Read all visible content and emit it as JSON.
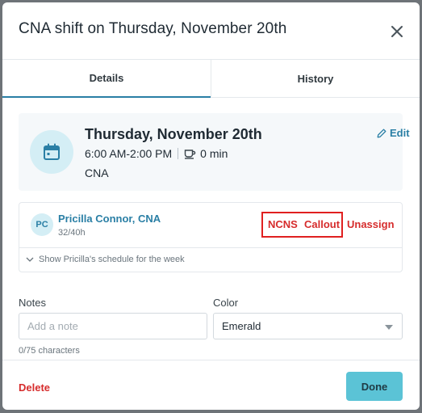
{
  "modal": {
    "title": "CNA shift on Thursday, November 20th"
  },
  "tabs": [
    {
      "label": "Details",
      "active": true
    },
    {
      "label": "History",
      "active": false
    }
  ],
  "shift": {
    "date": "Thursday, November 20th",
    "time": "6:00 AM-2:00 PM",
    "break": "0 min",
    "role": "CNA",
    "edit_label": "Edit",
    "icon": "calendar-icon",
    "break_icon": "coffee-cup-icon"
  },
  "assignment": {
    "initials": "PC",
    "name": "Pricilla Connor, CNA",
    "hours": "32/40h",
    "actions": {
      "ncns": "NCNS",
      "callout": "Callout",
      "unassign": "Unassign"
    },
    "show_schedule": "Show Pricilla's schedule for the week"
  },
  "form": {
    "notes_label": "Notes",
    "notes_placeholder": "Add a note",
    "char_count": "0/75 characters",
    "color_label": "Color",
    "color_value": "Emerald"
  },
  "footer": {
    "delete_label": "Delete",
    "done_label": "Done"
  },
  "colors": {
    "accent": "#2a7fa5",
    "danger": "#d62c2c",
    "primary_button": "#5bc3d6",
    "highlight": "#e02020"
  }
}
